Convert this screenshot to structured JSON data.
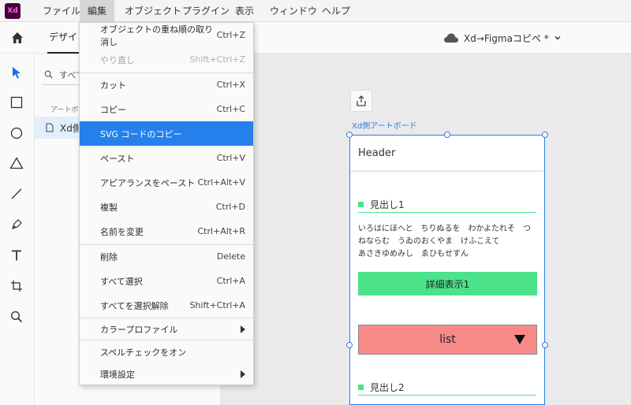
{
  "app": {
    "logo_text": "Xd"
  },
  "menubar": {
    "items": [
      "ファイル",
      "編集",
      "オブジェクト",
      "プラグイン",
      "表示",
      "ウィンドウ",
      "ヘルプ"
    ]
  },
  "toolbar": {
    "design_tab": "デザイン",
    "doc_title": "Xd→Figmaコピペ *"
  },
  "layers": {
    "search_text": "すべて",
    "section_label": "アートボ",
    "artboard_item": "Xd側"
  },
  "canvas": {
    "artboard_label": "Xd側アートボード",
    "header_text": "Header",
    "heading1": "見出し1",
    "body_lines": [
      "いろはにほへと　ちりぬるを　わかよたれそ　つ",
      "ねならむ　うゐのおくやま　けふこえて",
      "あさきゆめみし　ゑひもせすん"
    ],
    "button_label": "詳細表示1",
    "select_label": "list",
    "heading2": "見出し2",
    "accent_green": "#4be28a",
    "accent_red": "#f98a8a"
  },
  "edit_menu": {
    "items": [
      {
        "label": "オブジェクトの重ね順の取り消し",
        "shortcut": "Ctrl+Z"
      },
      {
        "label": "やり直し",
        "shortcut": "Shift+Ctrl+Z"
      },
      {
        "label": "カット",
        "shortcut": "Ctrl+X"
      },
      {
        "label": "コピー",
        "shortcut": "Ctrl+C"
      },
      {
        "label": "SVG コードのコピー",
        "shortcut": ""
      },
      {
        "label": "ペースト",
        "shortcut": "Ctrl+V"
      },
      {
        "label": "アピアランスをペースト",
        "shortcut": "Ctrl+Alt+V"
      },
      {
        "label": "複製",
        "shortcut": "Ctrl+D"
      },
      {
        "label": "名前を変更",
        "shortcut": "Ctrl+Alt+R"
      },
      {
        "label": "削除",
        "shortcut": "Delete"
      },
      {
        "label": "すべて選択",
        "shortcut": "Ctrl+A"
      },
      {
        "label": "すべてを選択解除",
        "shortcut": "Shift+Ctrl+A"
      },
      {
        "label": "カラープロファイル",
        "shortcut": ""
      },
      {
        "label": "スペルチェックをオン",
        "shortcut": ""
      },
      {
        "label": "環境設定",
        "shortcut": ""
      }
    ],
    "selected_color": "#2680eb"
  }
}
